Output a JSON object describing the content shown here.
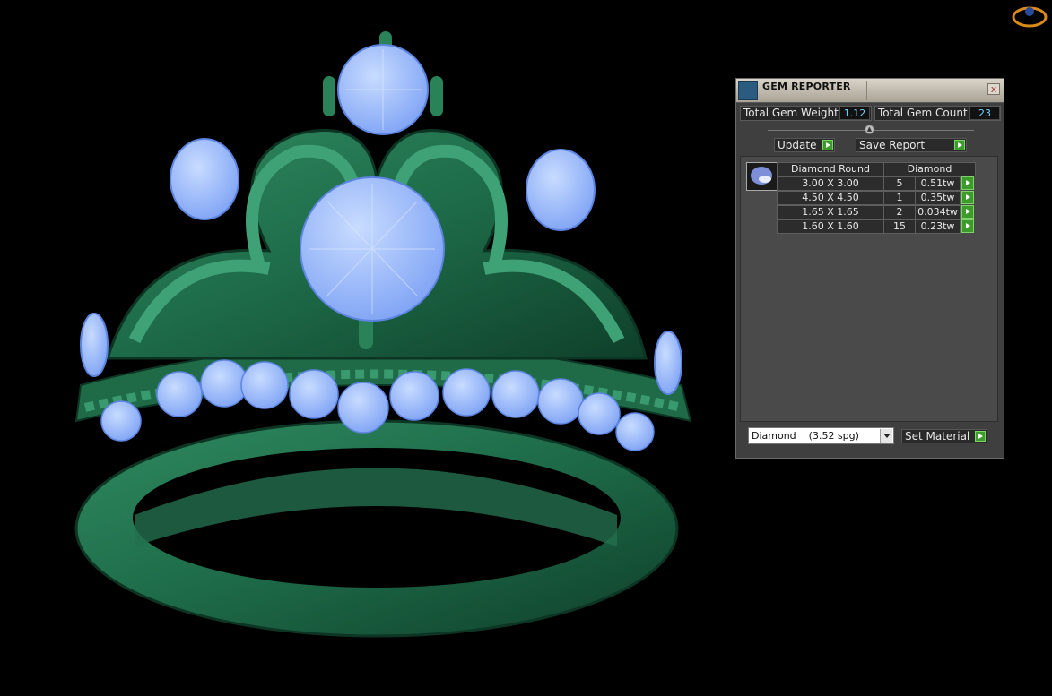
{
  "panel": {
    "title": "GEM REPORTER",
    "close_label": "x",
    "total_gem_weight_label": "Total Gem Weight",
    "total_gem_weight_value": "1.12",
    "total_gem_count_label": "Total Gem Count",
    "total_gem_count_value": "23",
    "update_label": "Update",
    "save_report_label": "Save Report",
    "table": {
      "headers": [
        "Diamond Round",
        "Diamond"
      ],
      "rows": [
        {
          "size": "3.00 X 3.00",
          "count": "5",
          "weight": "0.51tw"
        },
        {
          "size": "4.50 X 4.50",
          "count": "1",
          "weight": "0.35tw"
        },
        {
          "size": "1.65 X 1.65",
          "count": "2",
          "weight": "0.034tw"
        },
        {
          "size": "1.60 X 1.60",
          "count": "15",
          "weight": "0.23tw"
        }
      ]
    },
    "material_select_value": "Diamond    (3.52 spg)",
    "set_material_label": "Set Material"
  },
  "icons": {
    "title": "gem-reporter-icon",
    "close": "close-icon",
    "gem_thumb": "round-gem-icon",
    "nav": "view-navigator-icon"
  },
  "colors": {
    "metal": "#1e6b4a",
    "gem": "#8fb4ff",
    "panel_bg": "#3f3f3f",
    "accent_green": "#3c9b2b",
    "value_text": "#6fd0ff"
  }
}
